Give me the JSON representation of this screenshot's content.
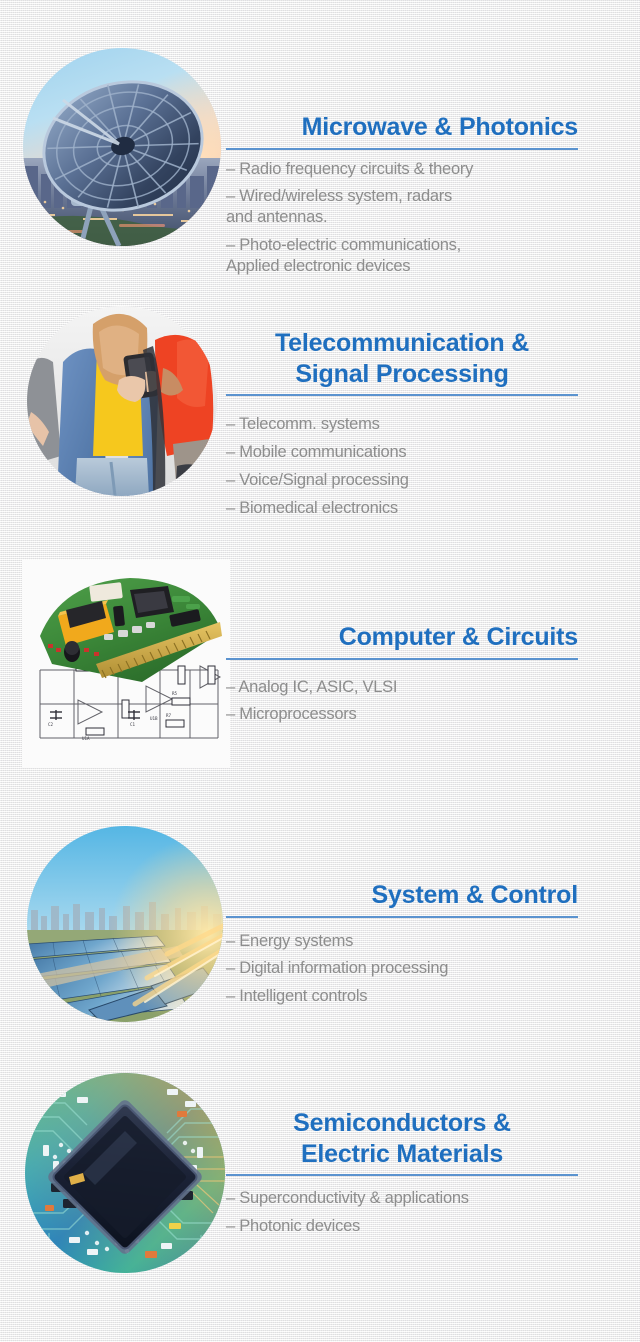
{
  "page": {
    "background_color": "#f2f2f0",
    "heading_color": "#1f6fbf",
    "rule_color": "#5b93cf",
    "body_text_color": "#8d8d8d"
  },
  "sections": [
    {
      "id": "microwave-photonics",
      "title": "Microwave & Photonics",
      "image_name": "satellite-dish-over-city-photo",
      "bullets": [
        "– Radio frequency circuits & theory",
        "– Wired/wireless system, radars\n and antennas.",
        "– Photo-electric communications,\nApplied electronic devices"
      ]
    },
    {
      "id": "telecommunication-signal-processing",
      "title": "Telecommunication &\nSignal Processing",
      "image_name": "people-using-smartphones-photo",
      "bullets": [
        "– Telecomm. systems",
        "– Mobile communications",
        "– Voice/Signal processing",
        "– Biomedical electronics"
      ]
    },
    {
      "id": "computer-circuits",
      "title": "Computer & Circuits",
      "image_name": "circuit-board-and-schematic-photo",
      "bullets": [
        "– Analog IC, ASIC, VLSI",
        "– Microprocessors"
      ]
    },
    {
      "id": "system-control",
      "title": "System & Control",
      "image_name": "solar-panel-farm-photo",
      "bullets": [
        "– Energy systems",
        "– Digital information processing",
        "– Intelligent controls"
      ]
    },
    {
      "id": "semiconductors-electric-materials",
      "title": "Semiconductors &\nElectric Materials",
      "image_name": "microchip-on-circuit-board-photo",
      "bullets": [
        "– Superconductivity & applications",
        "– Photonic devices"
      ]
    }
  ]
}
